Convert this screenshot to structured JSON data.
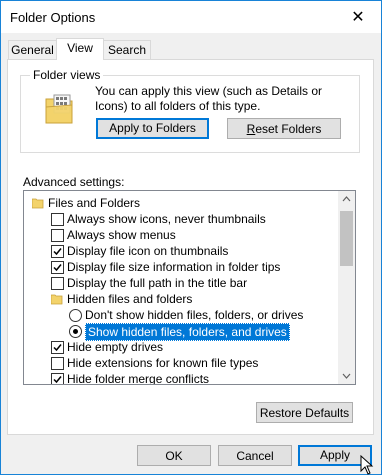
{
  "window": {
    "title": "Folder Options",
    "close_glyph": "✕"
  },
  "tabs": [
    {
      "label": "General",
      "active": false
    },
    {
      "label": "View",
      "active": true
    },
    {
      "label": "Search",
      "active": false
    }
  ],
  "folder_views": {
    "heading": "Folder views",
    "text": "You can apply this view (such as Details or Icons) to all folders of this type.",
    "apply_label": "Apply to Folders",
    "reset_label": "Reset Folders",
    "reset_underline_char": "R",
    "reset_rest": "eset Folders"
  },
  "advanced": {
    "label": "Advanced settings:",
    "items": [
      {
        "type": "folder",
        "label": "Files and Folders",
        "indent": 0
      },
      {
        "type": "checkbox",
        "label": "Always show icons, never thumbnails",
        "checked": false,
        "indent": 1
      },
      {
        "type": "checkbox",
        "label": "Always show menus",
        "checked": false,
        "indent": 1
      },
      {
        "type": "checkbox",
        "label": "Display file icon on thumbnails",
        "checked": true,
        "indent": 1
      },
      {
        "type": "checkbox",
        "label": "Display file size information in folder tips",
        "checked": true,
        "indent": 1
      },
      {
        "type": "checkbox",
        "label": "Display the full path in the title bar",
        "checked": false,
        "indent": 1
      },
      {
        "type": "folder",
        "label": "Hidden files and folders",
        "indent": 1
      },
      {
        "type": "radio",
        "label": "Don't show hidden files, folders, or drives",
        "checked": false,
        "indent": 2
      },
      {
        "type": "radio",
        "label": "Show hidden files, folders, and drives",
        "checked": true,
        "selected": true,
        "indent": 2
      },
      {
        "type": "checkbox",
        "label": "Hide empty drives",
        "checked": true,
        "indent": 1
      },
      {
        "type": "checkbox",
        "label": "Hide extensions for known file types",
        "checked": false,
        "indent": 1
      },
      {
        "type": "checkbox",
        "label": "Hide folder merge conflicts",
        "checked": true,
        "indent": 1
      }
    ]
  },
  "restore_label": "Restore Defaults",
  "buttons": {
    "ok": "OK",
    "cancel": "Cancel",
    "apply": "Apply"
  },
  "colors": {
    "accent": "#0078d7",
    "folder": "#f3d36b",
    "window_border": "#1883d7"
  }
}
